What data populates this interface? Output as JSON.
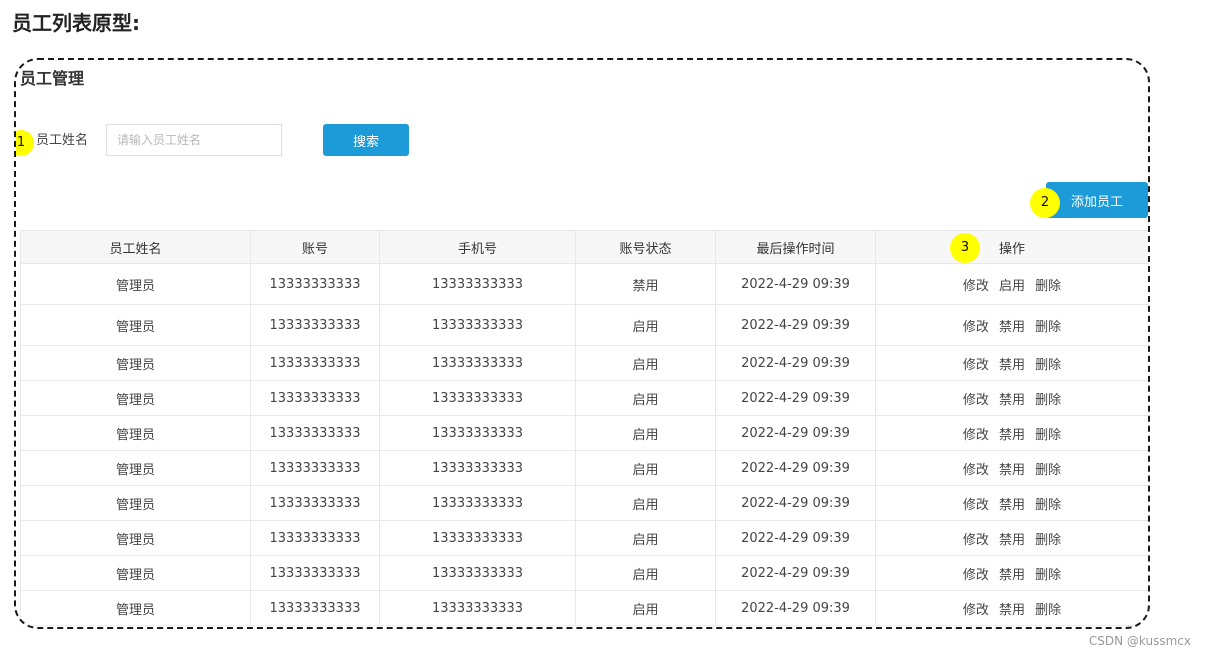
{
  "page": {
    "heading": "员工列表原型:"
  },
  "module": {
    "title": "员工管理",
    "markers": [
      "1",
      "2",
      "3"
    ],
    "search": {
      "label": "员工姓名",
      "placeholder": "请输入员工姓名",
      "value": "",
      "button_label": "搜索"
    },
    "add_button_label": "添加员工"
  },
  "table": {
    "columns": [
      "员工姓名",
      "账号",
      "手机号",
      "账号状态",
      "最后操作时间",
      "操作"
    ],
    "rows": [
      {
        "name": "管理员",
        "account": "13333333333",
        "phone": "13333333333",
        "status": "禁用",
        "last_time": "2022-4-29 09:39",
        "actions": [
          "修改",
          "启用",
          "删除"
        ]
      },
      {
        "name": "管理员",
        "account": "13333333333",
        "phone": "13333333333",
        "status": "启用",
        "last_time": "2022-4-29 09:39",
        "actions": [
          "修改",
          "禁用",
          "删除"
        ]
      },
      {
        "name": "管理员",
        "account": "13333333333",
        "phone": "13333333333",
        "status": "启用",
        "last_time": "2022-4-29 09:39",
        "actions": [
          "修改",
          "禁用",
          "删除"
        ]
      },
      {
        "name": "管理员",
        "account": "13333333333",
        "phone": "13333333333",
        "status": "启用",
        "last_time": "2022-4-29 09:39",
        "actions": [
          "修改",
          "禁用",
          "删除"
        ]
      },
      {
        "name": "管理员",
        "account": "13333333333",
        "phone": "13333333333",
        "status": "启用",
        "last_time": "2022-4-29 09:39",
        "actions": [
          "修改",
          "禁用",
          "删除"
        ]
      },
      {
        "name": "管理员",
        "account": "13333333333",
        "phone": "13333333333",
        "status": "启用",
        "last_time": "2022-4-29 09:39",
        "actions": [
          "修改",
          "禁用",
          "删除"
        ]
      },
      {
        "name": "管理员",
        "account": "13333333333",
        "phone": "13333333333",
        "status": "启用",
        "last_time": "2022-4-29 09:39",
        "actions": [
          "修改",
          "禁用",
          "删除"
        ]
      },
      {
        "name": "管理员",
        "account": "13333333333",
        "phone": "13333333333",
        "status": "启用",
        "last_time": "2022-4-29 09:39",
        "actions": [
          "修改",
          "禁用",
          "删除"
        ]
      },
      {
        "name": "管理员",
        "account": "13333333333",
        "phone": "13333333333",
        "status": "启用",
        "last_time": "2022-4-29 09:39",
        "actions": [
          "修改",
          "禁用",
          "删除"
        ]
      },
      {
        "name": "管理员",
        "account": "13333333333",
        "phone": "13333333333",
        "status": "启用",
        "last_time": "2022-4-29 09:39",
        "actions": [
          "修改",
          "禁用",
          "删除"
        ]
      }
    ]
  },
  "watermark": "CSDN @kussmcx",
  "colors": {
    "primary_button": "#1d9ad8",
    "marker": "#ffff00",
    "frame_border": "#1a1a1a"
  }
}
